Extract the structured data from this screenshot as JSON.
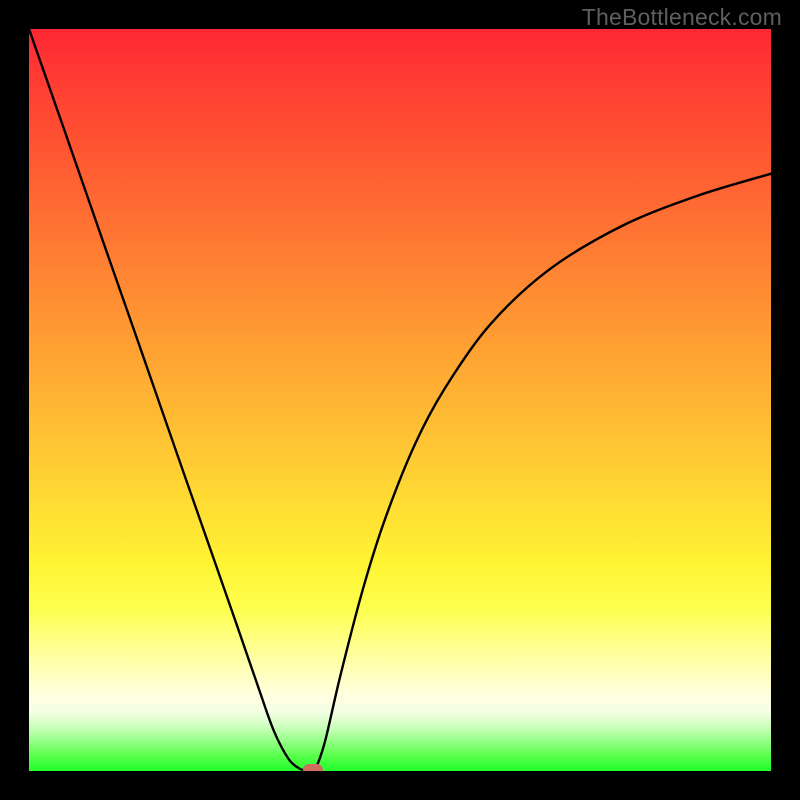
{
  "watermark": "TheBottleneck.com",
  "chart_data": {
    "type": "line",
    "title": "",
    "xlabel": "",
    "ylabel": "",
    "xlim": [
      0,
      100
    ],
    "ylim": [
      0,
      100
    ],
    "series": [
      {
        "name": "bottleneck-curve",
        "x": [
          0,
          5,
          10,
          15,
          20,
          25,
          28,
          31,
          33,
          35,
          36.5,
          37.5,
          38.3,
          39,
          40,
          42,
          45,
          48,
          52,
          56,
          62,
          70,
          80,
          90,
          100
        ],
        "values": [
          100,
          85.7,
          71.3,
          57,
          42.6,
          28.3,
          19.7,
          11,
          5.4,
          1.6,
          0.3,
          0.05,
          0.1,
          1.2,
          4.4,
          13,
          24.5,
          34,
          44,
          51.5,
          60,
          67.5,
          73.5,
          77.5,
          80.5
        ]
      }
    ],
    "marker": {
      "x": 38.3,
      "y": 0.15
    },
    "background_gradient": {
      "top_color": "#fe2733",
      "bottom_color": "#20ff2a",
      "meaning": "red=bad, green=good"
    }
  }
}
